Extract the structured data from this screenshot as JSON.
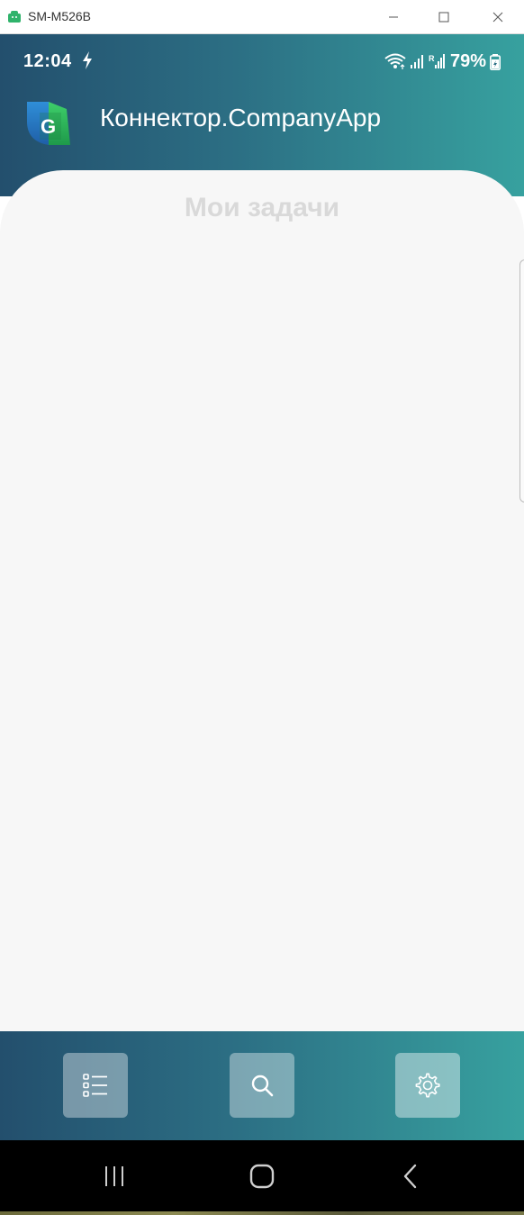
{
  "window": {
    "title": "SM-M526B",
    "icons": {
      "app": "android-icon",
      "minimize": "minimize-icon",
      "maximize": "maximize-icon",
      "close": "close-icon"
    }
  },
  "status_bar": {
    "time": "12:04",
    "battery": "79%",
    "icons": [
      "charging-bolt-icon",
      "wifi-icon",
      "signal-icon",
      "signal-r-icon",
      "battery-icon"
    ]
  },
  "app_header": {
    "title": "Коннектор.CompanyApp",
    "logo": "company-logo-icon"
  },
  "main": {
    "heading": "Мои задачи"
  },
  "bottom_nav": {
    "items": [
      {
        "icon": "task-list-icon"
      },
      {
        "icon": "search-icon"
      },
      {
        "icon": "gear-icon"
      }
    ]
  },
  "system_nav": {
    "items": [
      {
        "icon": "recent-apps-icon"
      },
      {
        "icon": "home-icon"
      },
      {
        "icon": "back-icon"
      }
    ]
  },
  "colors": {
    "gradient_start": "#234f6d",
    "gradient_end": "#37a19f",
    "card_background": "#f7f7f7",
    "heading_color": "#d9d9d9"
  }
}
